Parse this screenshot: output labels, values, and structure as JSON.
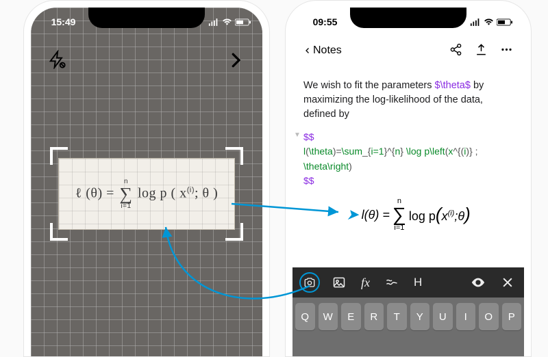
{
  "left_phone": {
    "status_time": "15:49",
    "handwritten_equation": "l(θ) = Σ_{i=1}^{n} log p ( x^{(i)} ; θ )"
  },
  "right_phone": {
    "status_time": "09:55",
    "back_label": "Notes",
    "paragraph_pre": "We wish to fit the parameters ",
    "paragraph_theta": "$\\theta$",
    "paragraph_post": " by maximizing the log-likelihood of the data, defined by",
    "latex_open": "$$",
    "latex_body_g1": "l",
    "latex_body_b1": "(",
    "latex_body_g2": "\\theta",
    "latex_body_b2": ")=",
    "latex_body_g3": "\\sum",
    "latex_body_b3": "_{",
    "latex_body_g4": "i=1",
    "latex_body_b4": "}^{",
    "latex_body_g5": "n",
    "latex_body_b5": "} ",
    "latex_body_g6": "\\log p\\left",
    "latex_body_b6": "(",
    "latex_body_g7": "x",
    "latex_body_b7": "^{(",
    "latex_body_g8": "i",
    "latex_body_b8": ")} ; ",
    "latex_body_g9": "\\theta\\right",
    "latex_body_b9": ")",
    "latex_close": "$$",
    "rendered": {
      "lhs": "l(θ) =",
      "sum_top": "n",
      "sum_bot": "i=1",
      "rhs1": "log p",
      "paren_l": "(",
      "x": "x",
      "sup": "(i)",
      "semi": ";",
      "theta": "θ",
      "paren_r": ")"
    },
    "toolbar_fx": "fx",
    "toolbar_h": "H",
    "keyboard_row": [
      "Q",
      "W",
      "E",
      "R",
      "T",
      "Y",
      "U",
      "I",
      "O",
      "P"
    ]
  }
}
